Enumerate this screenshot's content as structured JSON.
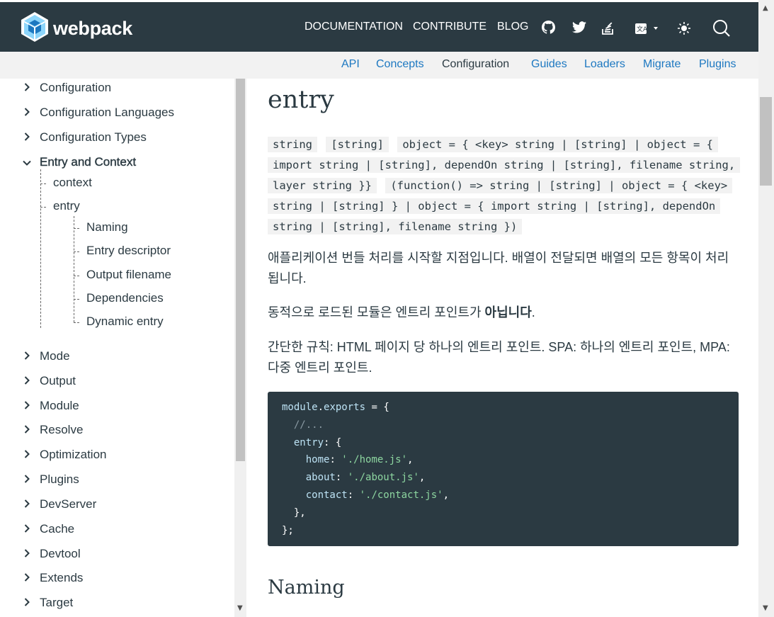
{
  "brand": {
    "name": "webpack"
  },
  "topnav": {
    "items": [
      "DOCUMENTATION",
      "CONTRIBUTE",
      "BLOG"
    ],
    "icons": [
      "github-icon",
      "twitter-icon",
      "stackoverflow-icon",
      "language-icon",
      "theme-toggle-icon",
      "search-icon"
    ]
  },
  "subnav": {
    "items": [
      "API",
      "Concepts",
      "Configuration",
      "Guides",
      "Loaders",
      "Migrate",
      "Plugins"
    ],
    "active": "Configuration"
  },
  "sidebar": {
    "top_items": [
      "Configuration",
      "Configuration Languages",
      "Configuration Types"
    ],
    "expanded": "Entry and Context",
    "children": [
      "context",
      "entry"
    ],
    "entry_children": [
      "Naming",
      "Entry descriptor",
      "Output filename",
      "Dependencies",
      "Dynamic entry"
    ],
    "bottom_items": [
      "Mode",
      "Output",
      "Module",
      "Resolve",
      "Optimization",
      "Plugins",
      "DevServer",
      "Cache",
      "Devtool",
      "Extends",
      "Target"
    ]
  },
  "content": {
    "title": "entry",
    "types": [
      "string",
      "[string]",
      "object = { <key> string | [string] | object = { import string | [string], dependOn string | [string], filename string, layer string }}",
      "(function() => string | [string] | object = { <key> string | [string] } | object = { import string | [string], dependOn string | [string], filename string })"
    ],
    "para1": "애플리케이션 번들 처리를 시작할 지점입니다. 배열이 전달되면 배열의 모든 항목이 처리됩니다.",
    "para2_prefix": "동적으로 로드된 모듈은 엔트리 포인트가 ",
    "para2_bold": "아닙니다",
    "para2_suffix": ".",
    "para3": "간단한 규칙: HTML 페이지 당 하나의 엔트리 포인트. SPA: 하나의 엔트리 포인트, MPA: 다중 엔트리 포인트.",
    "code": {
      "line1_a": "module",
      "line1_b": ".",
      "line1_c": "exports",
      "line1_d": " = {",
      "comment": "//...",
      "entry_key": "entry",
      "entry_rest": ": {",
      "home_key": "home",
      "home_val": "'./home.js'",
      "about_key": "about",
      "about_val": "'./about.js'",
      "contact_key": "contact",
      "contact_val": "'./contact.js'",
      "close_inner": "},",
      "close_outer": "};"
    },
    "next_heading": "Naming"
  }
}
